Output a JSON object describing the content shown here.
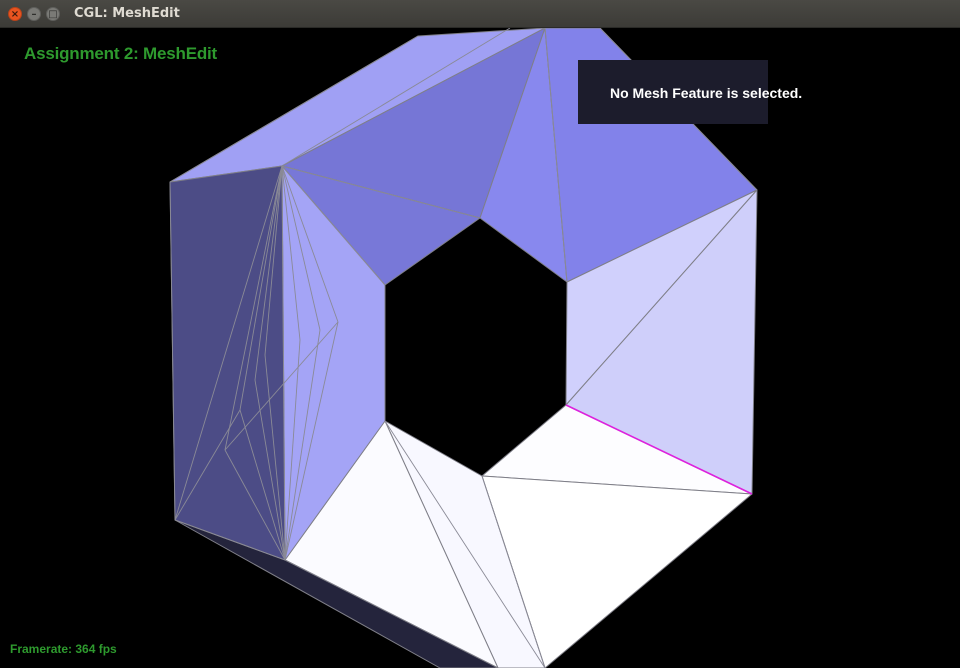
{
  "window": {
    "title": "CGL: MeshEdit",
    "close_glyph": "×",
    "minimize_glyph": "–",
    "maximize_glyph": "□"
  },
  "hud": {
    "assignment_title": "Assignment 2: MeshEdit",
    "selection_status": "No Mesh Feature is selected.",
    "framerate": "Framerate: 364 fps"
  },
  "colors": {
    "background": "#000000",
    "hud_text_green": "#2e9a2e",
    "selected_edge": "#dd22dd",
    "wireframe": "#7f7f88"
  }
}
